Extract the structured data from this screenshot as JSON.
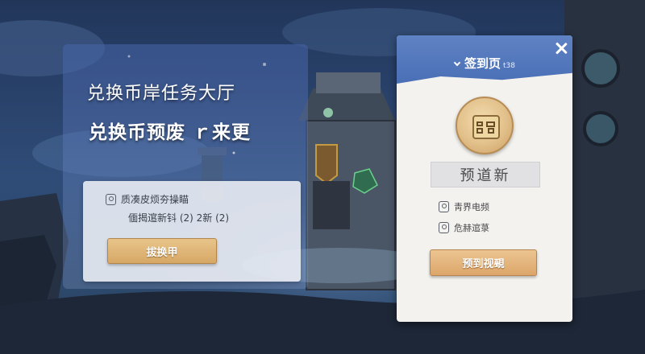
{
  "left_panel": {
    "title": "兑换币岸任务大厅",
    "subtitle": "兑换币预废 ｒ来更",
    "card": {
      "task_text": "质凑皮烦夯操瞄",
      "progress_text": "偭揭逭新钭 (2) 2新 (2)",
      "exchange_button": "拔换甲"
    }
  },
  "signin_panel": {
    "title": "签到页",
    "badge": "t38",
    "reward_name": "预道新",
    "rows": [
      {
        "label": "靑界电频"
      },
      {
        "label": "危赫逭菉"
      }
    ],
    "claim_button": "预到视覡"
  },
  "icons": {
    "left_row_icon": "user-card-icon",
    "right_row_icon": "user-card-icon",
    "reward_icon": "scroll-map-icon",
    "close_icon": "close-x-icon",
    "chevron_icon": "chevron-down-icon"
  },
  "colors": {
    "header_blue": "#5f82c4",
    "button_gold": "#dca66a",
    "panel_bg": "#f3f2ee"
  }
}
